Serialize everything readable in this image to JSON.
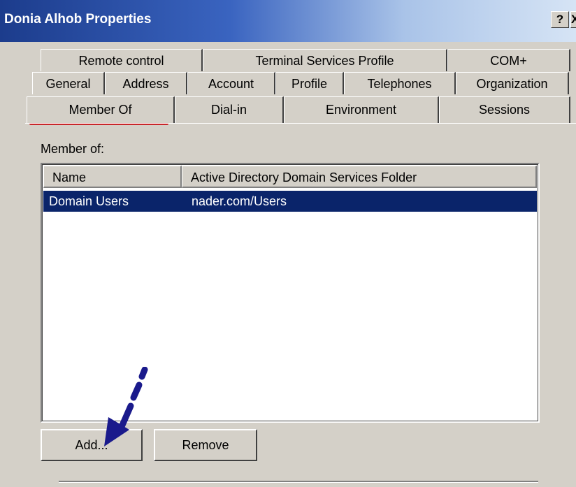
{
  "window": {
    "title": "Donia Alhob Properties",
    "help_label": "?",
    "close_label": "X"
  },
  "tabs": {
    "row1": [
      "Remote control",
      "Terminal Services Profile",
      "COM+"
    ],
    "row2": [
      "General",
      "Address",
      "Account",
      "Profile",
      "Telephones",
      "Organization"
    ],
    "row3": [
      "Member Of",
      "Dial-in",
      "Environment",
      "Sessions"
    ],
    "active": "Member Of"
  },
  "member_of": {
    "label": "Member of:",
    "columns": [
      "Name",
      "Active Directory Domain Services Folder"
    ],
    "rows": [
      {
        "name": "Domain Users",
        "folder": "nader.com/Users",
        "selected": true
      }
    ]
  },
  "buttons": {
    "add": "Add...",
    "remove": "Remove"
  },
  "colors": {
    "selection": "#0a246a",
    "highlight_box": "#c8262a",
    "annotation_arrow": "#1a1a8c"
  }
}
